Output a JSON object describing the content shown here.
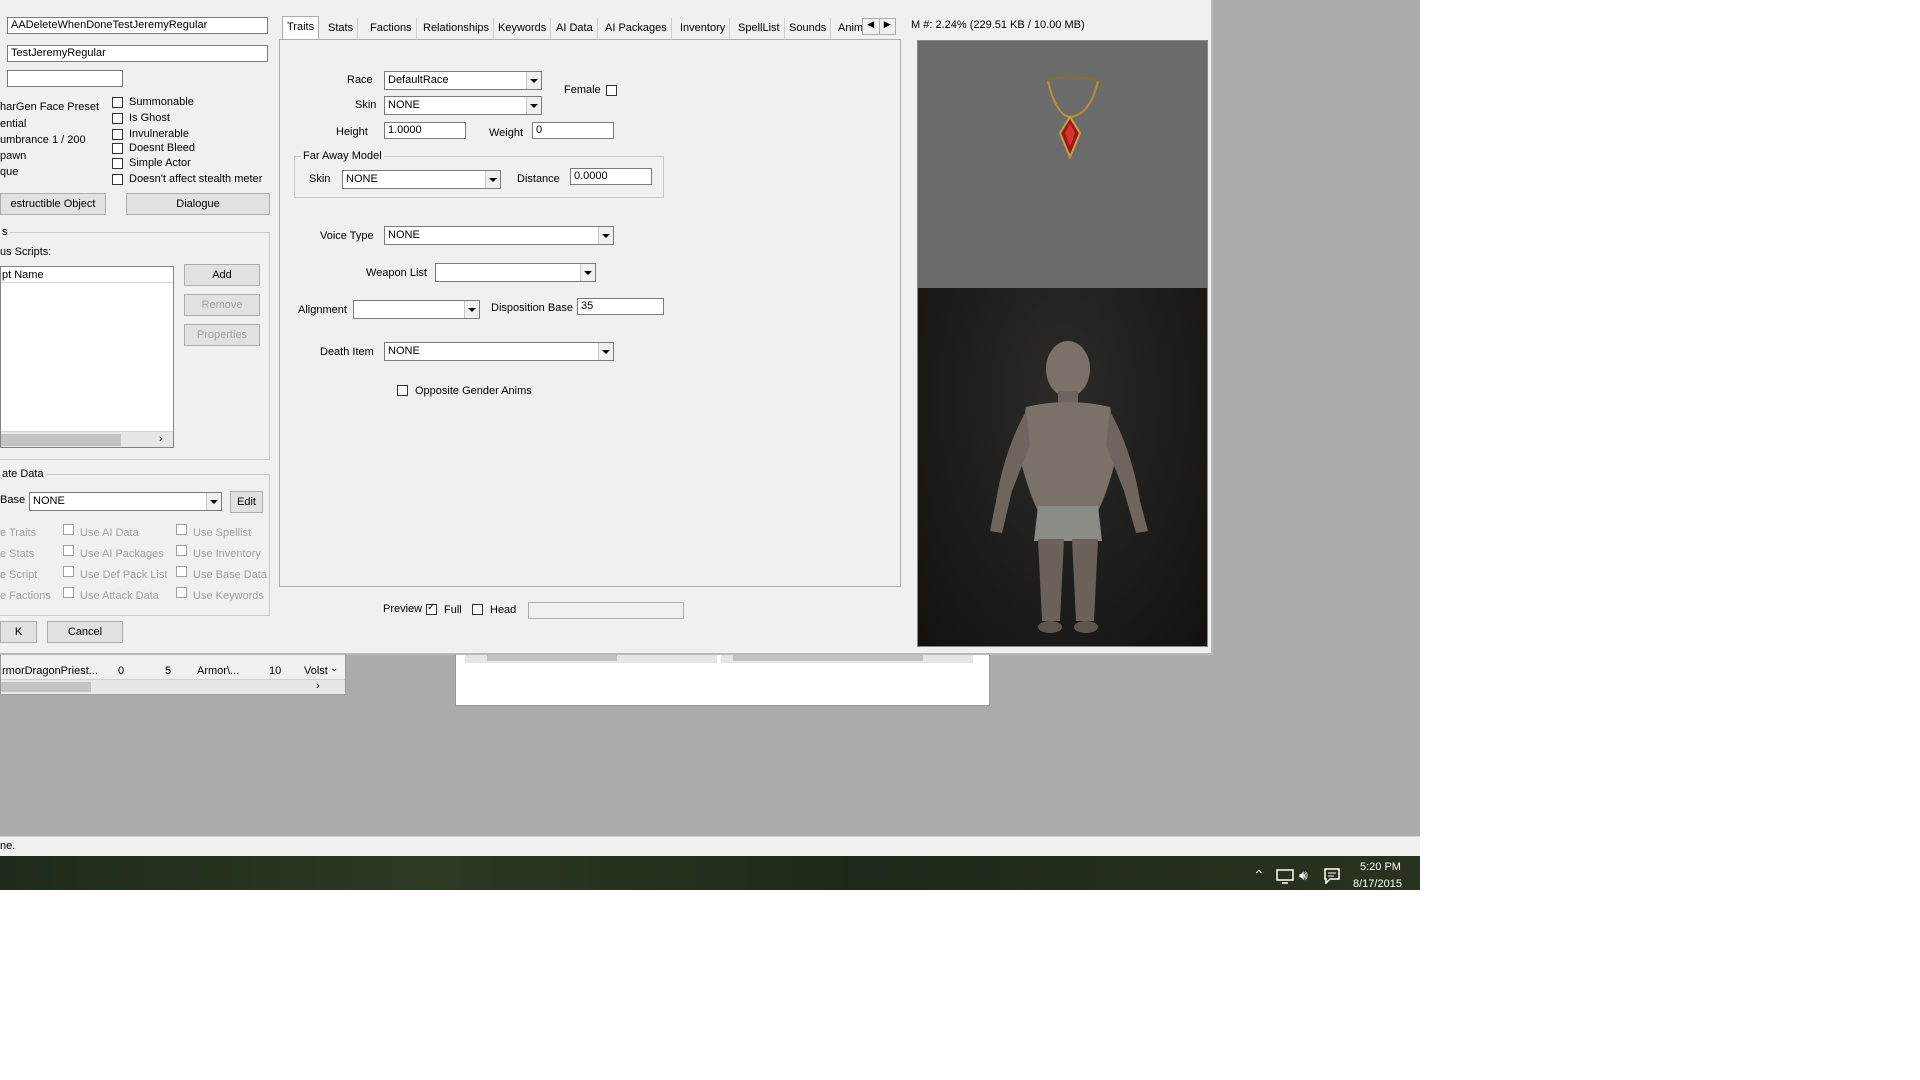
{
  "name_fields": {
    "editor_id": "AADeleteWhenDoneTestJeremyRegular",
    "full_name": "TestJeremyRegular",
    "third": ""
  },
  "left_labels": {
    "chargen_face_preset": "harGen Face Preset",
    "essential": "ential",
    "encumbrance": "umbrance 1 / 200",
    "respawn": "pawn",
    "unique": "que"
  },
  "flags": [
    {
      "label": "Summonable",
      "checked": false
    },
    {
      "label": "Is Ghost",
      "checked": false
    },
    {
      "label": "Invulnerable",
      "checked": false
    },
    {
      "label": "Doesnt Bleed",
      "checked": false
    },
    {
      "label": "Simple Actor",
      "checked": false
    },
    {
      "label": "Doesn't affect stealth meter",
      "checked": false
    }
  ],
  "buttons": {
    "destructible_object": "estructible Object",
    "dialogue": "Dialogue",
    "add": "Add",
    "remove": "Remove",
    "properties": "Properties",
    "edit": "Edit",
    "ok": "K",
    "cancel": "Cancel"
  },
  "scripts": {
    "group_title": "s",
    "label": "us Scripts:",
    "column_header": "pt Name"
  },
  "template": {
    "group_title": "ate Data",
    "base_label": "Base",
    "base_value": "NONE",
    "options": [
      {
        "label": "e Traits"
      },
      {
        "label": "Use AI Data"
      },
      {
        "label": "Use Spellist"
      },
      {
        "label": "e Stats"
      },
      {
        "label": "Use AI Packages"
      },
      {
        "label": "Use Inventory"
      },
      {
        "label": "e Script"
      },
      {
        "label": "Use Def Pack List"
      },
      {
        "label": "Use Base Data"
      },
      {
        "label": "e Factions"
      },
      {
        "label": "Use Attack Data"
      },
      {
        "label": "Use Keywords"
      }
    ]
  },
  "tabs": [
    {
      "label": "Traits",
      "active": true
    },
    {
      "label": "Stats"
    },
    {
      "label": "Factions"
    },
    {
      "label": "Relationships"
    },
    {
      "label": "Keywords"
    },
    {
      "label": "AI Data"
    },
    {
      "label": "AI Packages"
    },
    {
      "label": "Inventory"
    },
    {
      "label": "SpellList"
    },
    {
      "label": "Sounds"
    },
    {
      "label": "Anim"
    }
  ],
  "traits": {
    "race_label": "Race",
    "race_value": "DefaultRace",
    "female_label": "Female",
    "skin_label": "Skin",
    "skin_value": "NONE",
    "height_label": "Height",
    "height_value": "1.0000",
    "weight_label": "Weight",
    "weight_value": "0",
    "far_away_title": "Far Away Model",
    "fa_skin_label": "Skin",
    "fa_skin_value": "NONE",
    "distance_label": "Distance",
    "distance_value": "0.0000",
    "voice_type_label": "Voice Type",
    "voice_type_value": "NONE",
    "weapon_list_label": "Weapon List",
    "weapon_list_value": "",
    "alignment_label": "Alignment",
    "alignment_value": "",
    "disposition_label": "Disposition Base",
    "disposition_value": "35",
    "death_item_label": "Death Item",
    "death_item_value": "NONE",
    "opposite_gender_label": "Opposite Gender Anims"
  },
  "preview_controls": {
    "preview_label": "Preview",
    "full_label": "Full",
    "full_checked": true,
    "head_label": "Head",
    "head_checked": false
  },
  "memory_readout": "M #: 2.24% (229.51 KB / 10.00 MB)",
  "bg_list_row": {
    "name": "rmorDragonPriest...",
    "c1": "0",
    "c2": "5",
    "c3": "Armor\\...",
    "c4": "10",
    "c5": "Volst"
  },
  "status_text": "ne.",
  "tray": {
    "time": "5:20 PM",
    "date": "8/17/2015"
  }
}
